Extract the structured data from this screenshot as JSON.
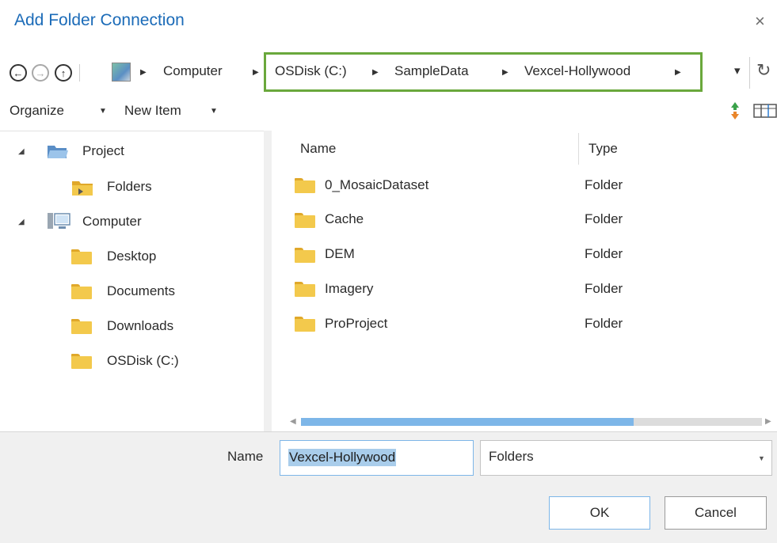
{
  "window": {
    "title": "Add Folder Connection",
    "close_glyph": "×"
  },
  "nav": {
    "back_glyph": "←",
    "forward_glyph": "→",
    "up_glyph": "↑",
    "breadcrumbs": [
      "Computer",
      "OSDisk (C:)",
      "SampleData",
      "Vexcel-Hollywood"
    ],
    "dropdown_glyph": "▾",
    "refresh_glyph": "↻"
  },
  "toolbar": {
    "organize": "Organize",
    "new_item": "New Item",
    "sort_icon": "sort-icon",
    "view_icon": "view-columns-icon"
  },
  "tree": {
    "project": "Project",
    "folders": "Folders",
    "computer": "Computer",
    "desktop": "Desktop",
    "documents": "Documents",
    "downloads": "Downloads",
    "osdisk": "OSDisk (C:)"
  },
  "content": {
    "col_name": "Name",
    "col_type": "Type",
    "rows": [
      {
        "name": "0_MosaicDataset",
        "type": "Folder"
      },
      {
        "name": "Cache",
        "type": "Folder"
      },
      {
        "name": "DEM",
        "type": "Folder"
      },
      {
        "name": "Imagery",
        "type": "Folder"
      },
      {
        "name": "ProProject",
        "type": "Folder"
      }
    ]
  },
  "footer": {
    "name_label": "Name",
    "name_value": "Vexcel-Hollywood",
    "type_value": "Folders",
    "ok": "OK",
    "cancel": "Cancel"
  },
  "colors": {
    "title_blue": "#1b6bb8",
    "highlight_green": "#6aa83c",
    "folder_yellow": "#f3c94c",
    "selection_blue": "#a9cdeb"
  }
}
